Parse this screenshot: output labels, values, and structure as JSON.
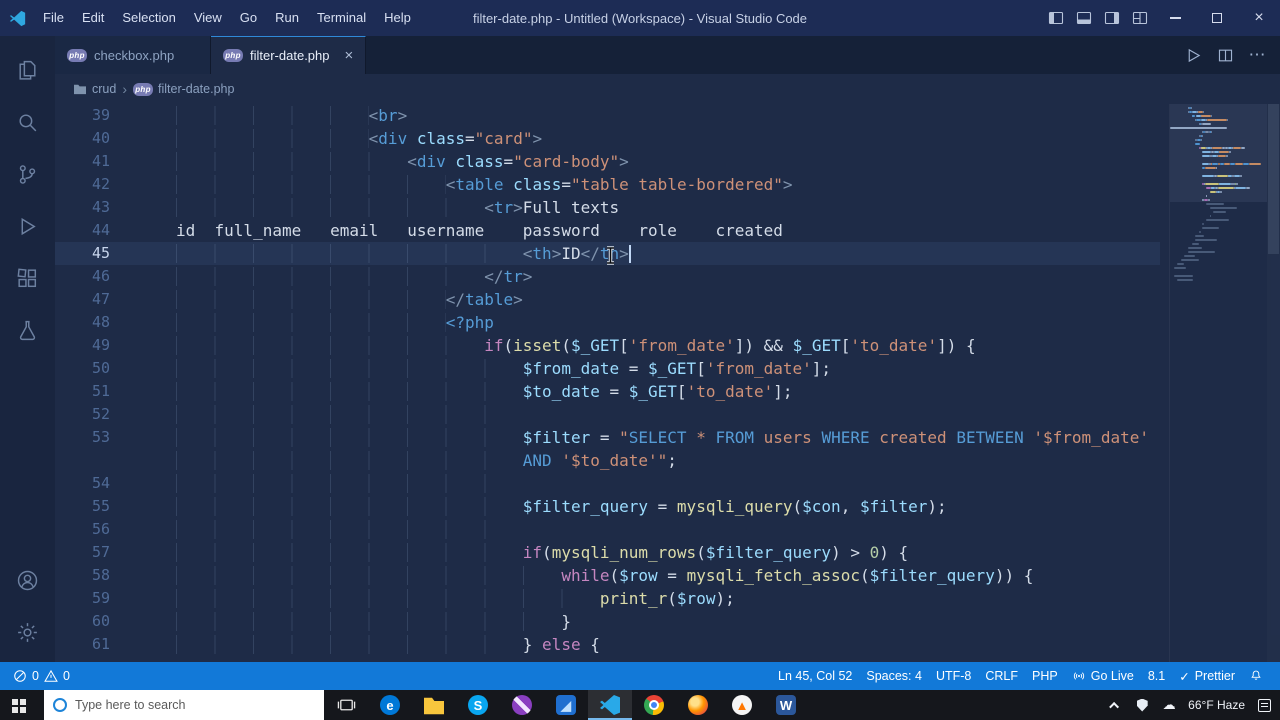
{
  "icons": {
    "php_badge": "php",
    "close": "×",
    "ellipsis": "⋯",
    "check": "✓",
    "chevron": "›",
    "cloud": "☁"
  },
  "title_bar": {
    "menus": [
      "File",
      "Edit",
      "Selection",
      "View",
      "Go",
      "Run",
      "Terminal",
      "Help"
    ],
    "title": "filter-date.php - Untitled (Workspace) - Visual Studio Code"
  },
  "tabs": [
    {
      "label": "checkbox.php",
      "active": false
    },
    {
      "label": "filter-date.php",
      "active": true
    }
  ],
  "breadcrumb": {
    "folder": "crud",
    "file": "filter-date.php"
  },
  "editor": {
    "active_line": 45,
    "cursor": "Ln 45, Col 52",
    "lines": [
      {
        "n": "39",
        "t": [
          [
            "ind",
            "                    "
          ],
          [
            "br",
            "<"
          ],
          [
            "tag",
            "br"
          ],
          [
            "br",
            ">"
          ]
        ]
      },
      {
        "n": "40",
        "t": [
          [
            "ind",
            "                    "
          ],
          [
            "br",
            "<"
          ],
          [
            "tag",
            "div"
          ],
          [
            "p",
            " "
          ],
          [
            "attr",
            "class"
          ],
          [
            "p",
            "="
          ],
          [
            "str",
            "\"card\""
          ],
          [
            "br",
            ">"
          ]
        ]
      },
      {
        "n": "41",
        "t": [
          [
            "ind",
            "                        "
          ],
          [
            "br",
            "<"
          ],
          [
            "tag",
            "div"
          ],
          [
            "p",
            " "
          ],
          [
            "attr",
            "class"
          ],
          [
            "p",
            "="
          ],
          [
            "str",
            "\"card-body\""
          ],
          [
            "br",
            ">"
          ]
        ]
      },
      {
        "n": "42",
        "t": [
          [
            "ind",
            "                            "
          ],
          [
            "br",
            "<"
          ],
          [
            "tag",
            "table"
          ],
          [
            "p",
            " "
          ],
          [
            "attr",
            "class"
          ],
          [
            "p",
            "="
          ],
          [
            "str",
            "\"table table-bordered\""
          ],
          [
            "br",
            ">"
          ]
        ]
      },
      {
        "n": "43",
        "t": [
          [
            "ind",
            "                                "
          ],
          [
            "br",
            "<"
          ],
          [
            "tag",
            "tr"
          ],
          [
            "br",
            ">"
          ],
          [
            "txt",
            "Full texts"
          ]
        ]
      },
      {
        "n": "44",
        "t": [
          [
            "txt",
            "id  full_name   email   username    password    role    created"
          ]
        ]
      },
      {
        "n": "45",
        "active": true,
        "caret": true,
        "t": [
          [
            "ind",
            "                                    "
          ],
          [
            "br",
            "<"
          ],
          [
            "tag",
            "th"
          ],
          [
            "br",
            ">"
          ],
          [
            "txt",
            "ID"
          ],
          [
            "br",
            "</"
          ],
          [
            "tag",
            "th"
          ],
          [
            "br",
            ">"
          ]
        ]
      },
      {
        "n": "46",
        "t": [
          [
            "ind",
            "                                "
          ],
          [
            "br",
            "</"
          ],
          [
            "tag",
            "tr"
          ],
          [
            "br",
            ">"
          ]
        ]
      },
      {
        "n": "47",
        "t": [
          [
            "ind",
            "                            "
          ],
          [
            "br",
            "</"
          ],
          [
            "tag",
            "table"
          ],
          [
            "br",
            ">"
          ]
        ]
      },
      {
        "n": "48",
        "t": [
          [
            "ind",
            "                            "
          ],
          [
            "php",
            "<?php"
          ]
        ]
      },
      {
        "n": "49",
        "t": [
          [
            "ind",
            "                                "
          ],
          [
            "kw",
            "if"
          ],
          [
            "p",
            "("
          ],
          [
            "fn",
            "isset"
          ],
          [
            "p",
            "("
          ],
          [
            "var",
            "$_GET"
          ],
          [
            "p",
            "["
          ],
          [
            "str",
            "'from_date'"
          ],
          [
            "p",
            "]) "
          ],
          [
            "p",
            "&& "
          ],
          [
            "var",
            "$_GET"
          ],
          [
            "p",
            "["
          ],
          [
            "str",
            "'to_date'"
          ],
          [
            "p",
            "]) {"
          ]
        ]
      },
      {
        "n": "50",
        "t": [
          [
            "ind",
            "                                    "
          ],
          [
            "var",
            "$from_date"
          ],
          [
            "p",
            " = "
          ],
          [
            "var",
            "$_GET"
          ],
          [
            "p",
            "["
          ],
          [
            "str",
            "'from_date'"
          ],
          [
            "p",
            "];"
          ]
        ]
      },
      {
        "n": "51",
        "t": [
          [
            "ind",
            "                                    "
          ],
          [
            "var",
            "$to_date"
          ],
          [
            "p",
            " = "
          ],
          [
            "var",
            "$_GET"
          ],
          [
            "p",
            "["
          ],
          [
            "str",
            "'to_date'"
          ],
          [
            "p",
            "];"
          ]
        ]
      },
      {
        "n": "52",
        "t": [
          [
            "ind",
            "                                    "
          ]
        ]
      },
      {
        "n": "53",
        "t": [
          [
            "ind",
            "                                    "
          ],
          [
            "var",
            "$filter"
          ],
          [
            "p",
            " = "
          ],
          [
            "str",
            "\""
          ],
          [
            "sql",
            "SELECT"
          ],
          [
            "str",
            " * "
          ],
          [
            "sql",
            "FROM"
          ],
          [
            "str",
            " users "
          ],
          [
            "sql",
            "WHERE"
          ],
          [
            "str",
            " created "
          ],
          [
            "sql",
            "BETWEEN"
          ],
          [
            "str",
            " '$from_date'"
          ]
        ]
      },
      {
        "n": "",
        "t": [
          [
            "ind",
            "                                    "
          ],
          [
            "sql",
            "AND"
          ],
          [
            "str",
            " '$to_date'\""
          ],
          [
            "p",
            ";"
          ]
        ]
      },
      {
        "n": "54",
        "t": [
          [
            "ind",
            "                                    "
          ]
        ]
      },
      {
        "n": "55",
        "t": [
          [
            "ind",
            "                                    "
          ],
          [
            "var",
            "$filter_query"
          ],
          [
            "p",
            " = "
          ],
          [
            "fn",
            "mysqli_query"
          ],
          [
            "p",
            "("
          ],
          [
            "var",
            "$con"
          ],
          [
            "p",
            ", "
          ],
          [
            "var",
            "$filter"
          ],
          [
            "p",
            ");"
          ]
        ]
      },
      {
        "n": "56",
        "t": [
          [
            "ind",
            "                                    "
          ]
        ]
      },
      {
        "n": "57",
        "t": [
          [
            "ind",
            "                                    "
          ],
          [
            "kw",
            "if"
          ],
          [
            "p",
            "("
          ],
          [
            "fn",
            "mysqli_num_rows"
          ],
          [
            "p",
            "("
          ],
          [
            "var",
            "$filter_query"
          ],
          [
            "p",
            ") "
          ],
          [
            "p",
            "> "
          ],
          [
            "num",
            "0"
          ],
          [
            "p",
            ") {"
          ]
        ]
      },
      {
        "n": "58",
        "t": [
          [
            "ind",
            "                                        "
          ],
          [
            "kw",
            "while"
          ],
          [
            "p",
            "("
          ],
          [
            "var",
            "$row"
          ],
          [
            "p",
            " = "
          ],
          [
            "fn",
            "mysqli_fetch_assoc"
          ],
          [
            "p",
            "("
          ],
          [
            "var",
            "$filter_query"
          ],
          [
            "p",
            ")) {"
          ]
        ]
      },
      {
        "n": "59",
        "t": [
          [
            "ind",
            "                                            "
          ],
          [
            "fn",
            "print_r"
          ],
          [
            "p",
            "("
          ],
          [
            "var",
            "$row"
          ],
          [
            "p",
            ");"
          ]
        ]
      },
      {
        "n": "60",
        "t": [
          [
            "ind",
            "                                        "
          ],
          [
            "p",
            "}"
          ]
        ]
      },
      {
        "n": "61",
        "t": [
          [
            "ind",
            "                                    "
          ],
          [
            "p",
            "} "
          ],
          [
            "kw",
            "else"
          ],
          [
            "p",
            " {"
          ]
        ]
      }
    ]
  },
  "status_bar": {
    "errors": "0",
    "warnings": "0",
    "line_col": "Ln 45, Col 52",
    "spaces": "Spaces: 4",
    "encoding": "UTF-8",
    "eol": "CRLF",
    "language": "PHP",
    "go_live": "Go Live",
    "php_version": "8.1",
    "prettier": "Prettier"
  },
  "taskbar": {
    "search_placeholder": "Type here to search",
    "weather": "66°F Haze",
    "apps": [
      {
        "name": "edge",
        "shape": "circle",
        "bg": "#0078d7",
        "glyph": "e",
        "fg": "#ffffff"
      },
      {
        "name": "file-explorer",
        "shape": "folder",
        "bg": "#f8c63d",
        "glyph": ""
      },
      {
        "name": "skype",
        "shape": "circle",
        "bg": "#09a6f0",
        "glyph": "S",
        "fg": "#ffffff"
      },
      {
        "name": "design-app",
        "shape": "pen",
        "glyph": ""
      },
      {
        "name": "photos",
        "shape": "rsquare",
        "bg": "#1f6fd0",
        "glyph": "◢",
        "fg": "#bfe0ff"
      },
      {
        "name": "vscode",
        "shape": "vscode",
        "bg": "#29a9e8",
        "glyph": "",
        "active": true
      },
      {
        "name": "chrome",
        "shape": "chrome",
        "glyph": ""
      },
      {
        "name": "firefox",
        "shape": "firefox",
        "glyph": ""
      },
      {
        "name": "vlc",
        "shape": "circle",
        "bg": "#f5f5f5",
        "glyph": "▲",
        "fg": "#ff7700"
      },
      {
        "name": "word",
        "shape": "rsquare",
        "bg": "#2b579a",
        "glyph": "W",
        "fg": "#ffffff"
      }
    ]
  }
}
